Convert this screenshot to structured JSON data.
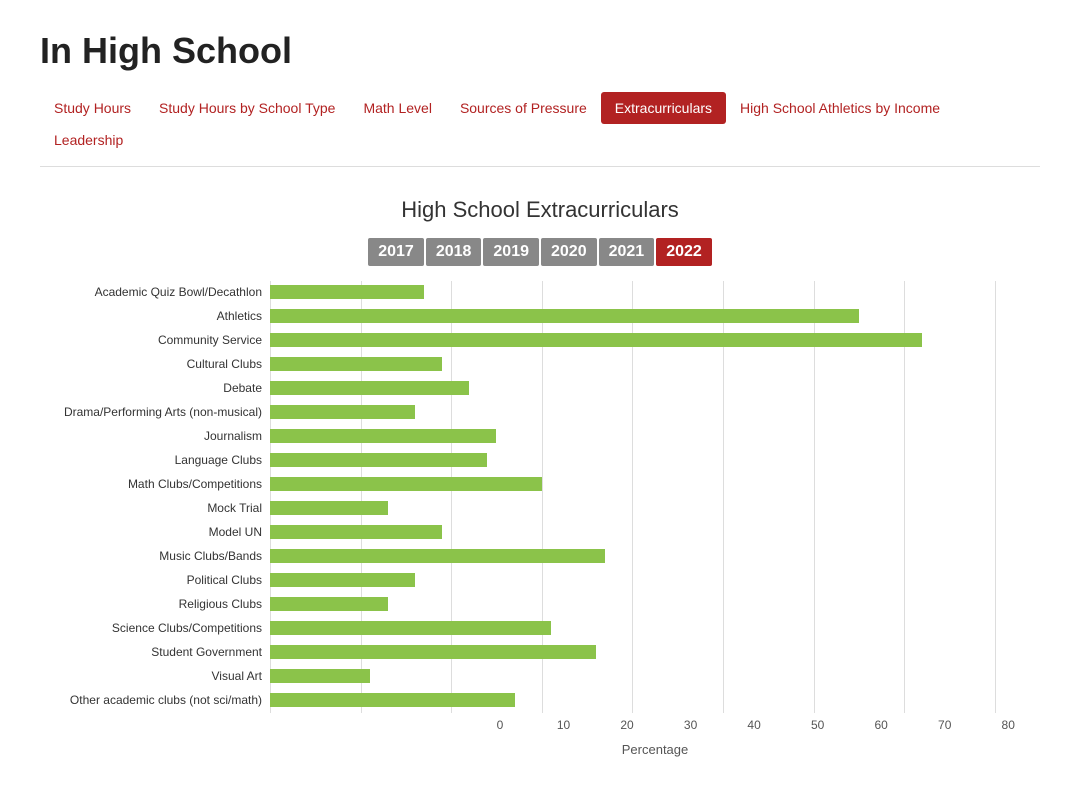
{
  "page": {
    "title": "In High School"
  },
  "nav": {
    "tabs": [
      {
        "label": "Study Hours",
        "active": false
      },
      {
        "label": "Study Hours by School Type",
        "active": false
      },
      {
        "label": "Math Level",
        "active": false
      },
      {
        "label": "Sources of Pressure",
        "active": false
      },
      {
        "label": "Extracurriculars",
        "active": true
      },
      {
        "label": "High School Athletics by Income",
        "active": false
      },
      {
        "label": "Leadership",
        "active": false
      }
    ]
  },
  "chart": {
    "title": "High School Extracurriculars",
    "years": [
      "2017",
      "2018",
      "2019",
      "2020",
      "2021",
      "2022"
    ],
    "x_label": "Percentage",
    "x_ticks": [
      0,
      10,
      20,
      30,
      40,
      50,
      60,
      70,
      80
    ],
    "x_max": 85,
    "bars": [
      {
        "label": "Academic Quiz Bowl/Decathlon",
        "value": 17
      },
      {
        "label": "Athletics",
        "value": 65
      },
      {
        "label": "Community Service",
        "value": 72
      },
      {
        "label": "Cultural Clubs",
        "value": 19
      },
      {
        "label": "Debate",
        "value": 22
      },
      {
        "label": "Drama/Performing Arts (non-musical)",
        "value": 16
      },
      {
        "label": "Journalism",
        "value": 25
      },
      {
        "label": "Language Clubs",
        "value": 24
      },
      {
        "label": "Math Clubs/Competitions",
        "value": 30
      },
      {
        "label": "Mock Trial",
        "value": 13
      },
      {
        "label": "Model UN",
        "value": 19
      },
      {
        "label": "Music Clubs/Bands",
        "value": 37
      },
      {
        "label": "Political Clubs",
        "value": 16
      },
      {
        "label": "Religious Clubs",
        "value": 13
      },
      {
        "label": "Science Clubs/Competitions",
        "value": 31
      },
      {
        "label": "Student Government",
        "value": 36
      },
      {
        "label": "Visual Art",
        "value": 11
      },
      {
        "label": "Other academic clubs (not sci/math)",
        "value": 27
      }
    ]
  }
}
